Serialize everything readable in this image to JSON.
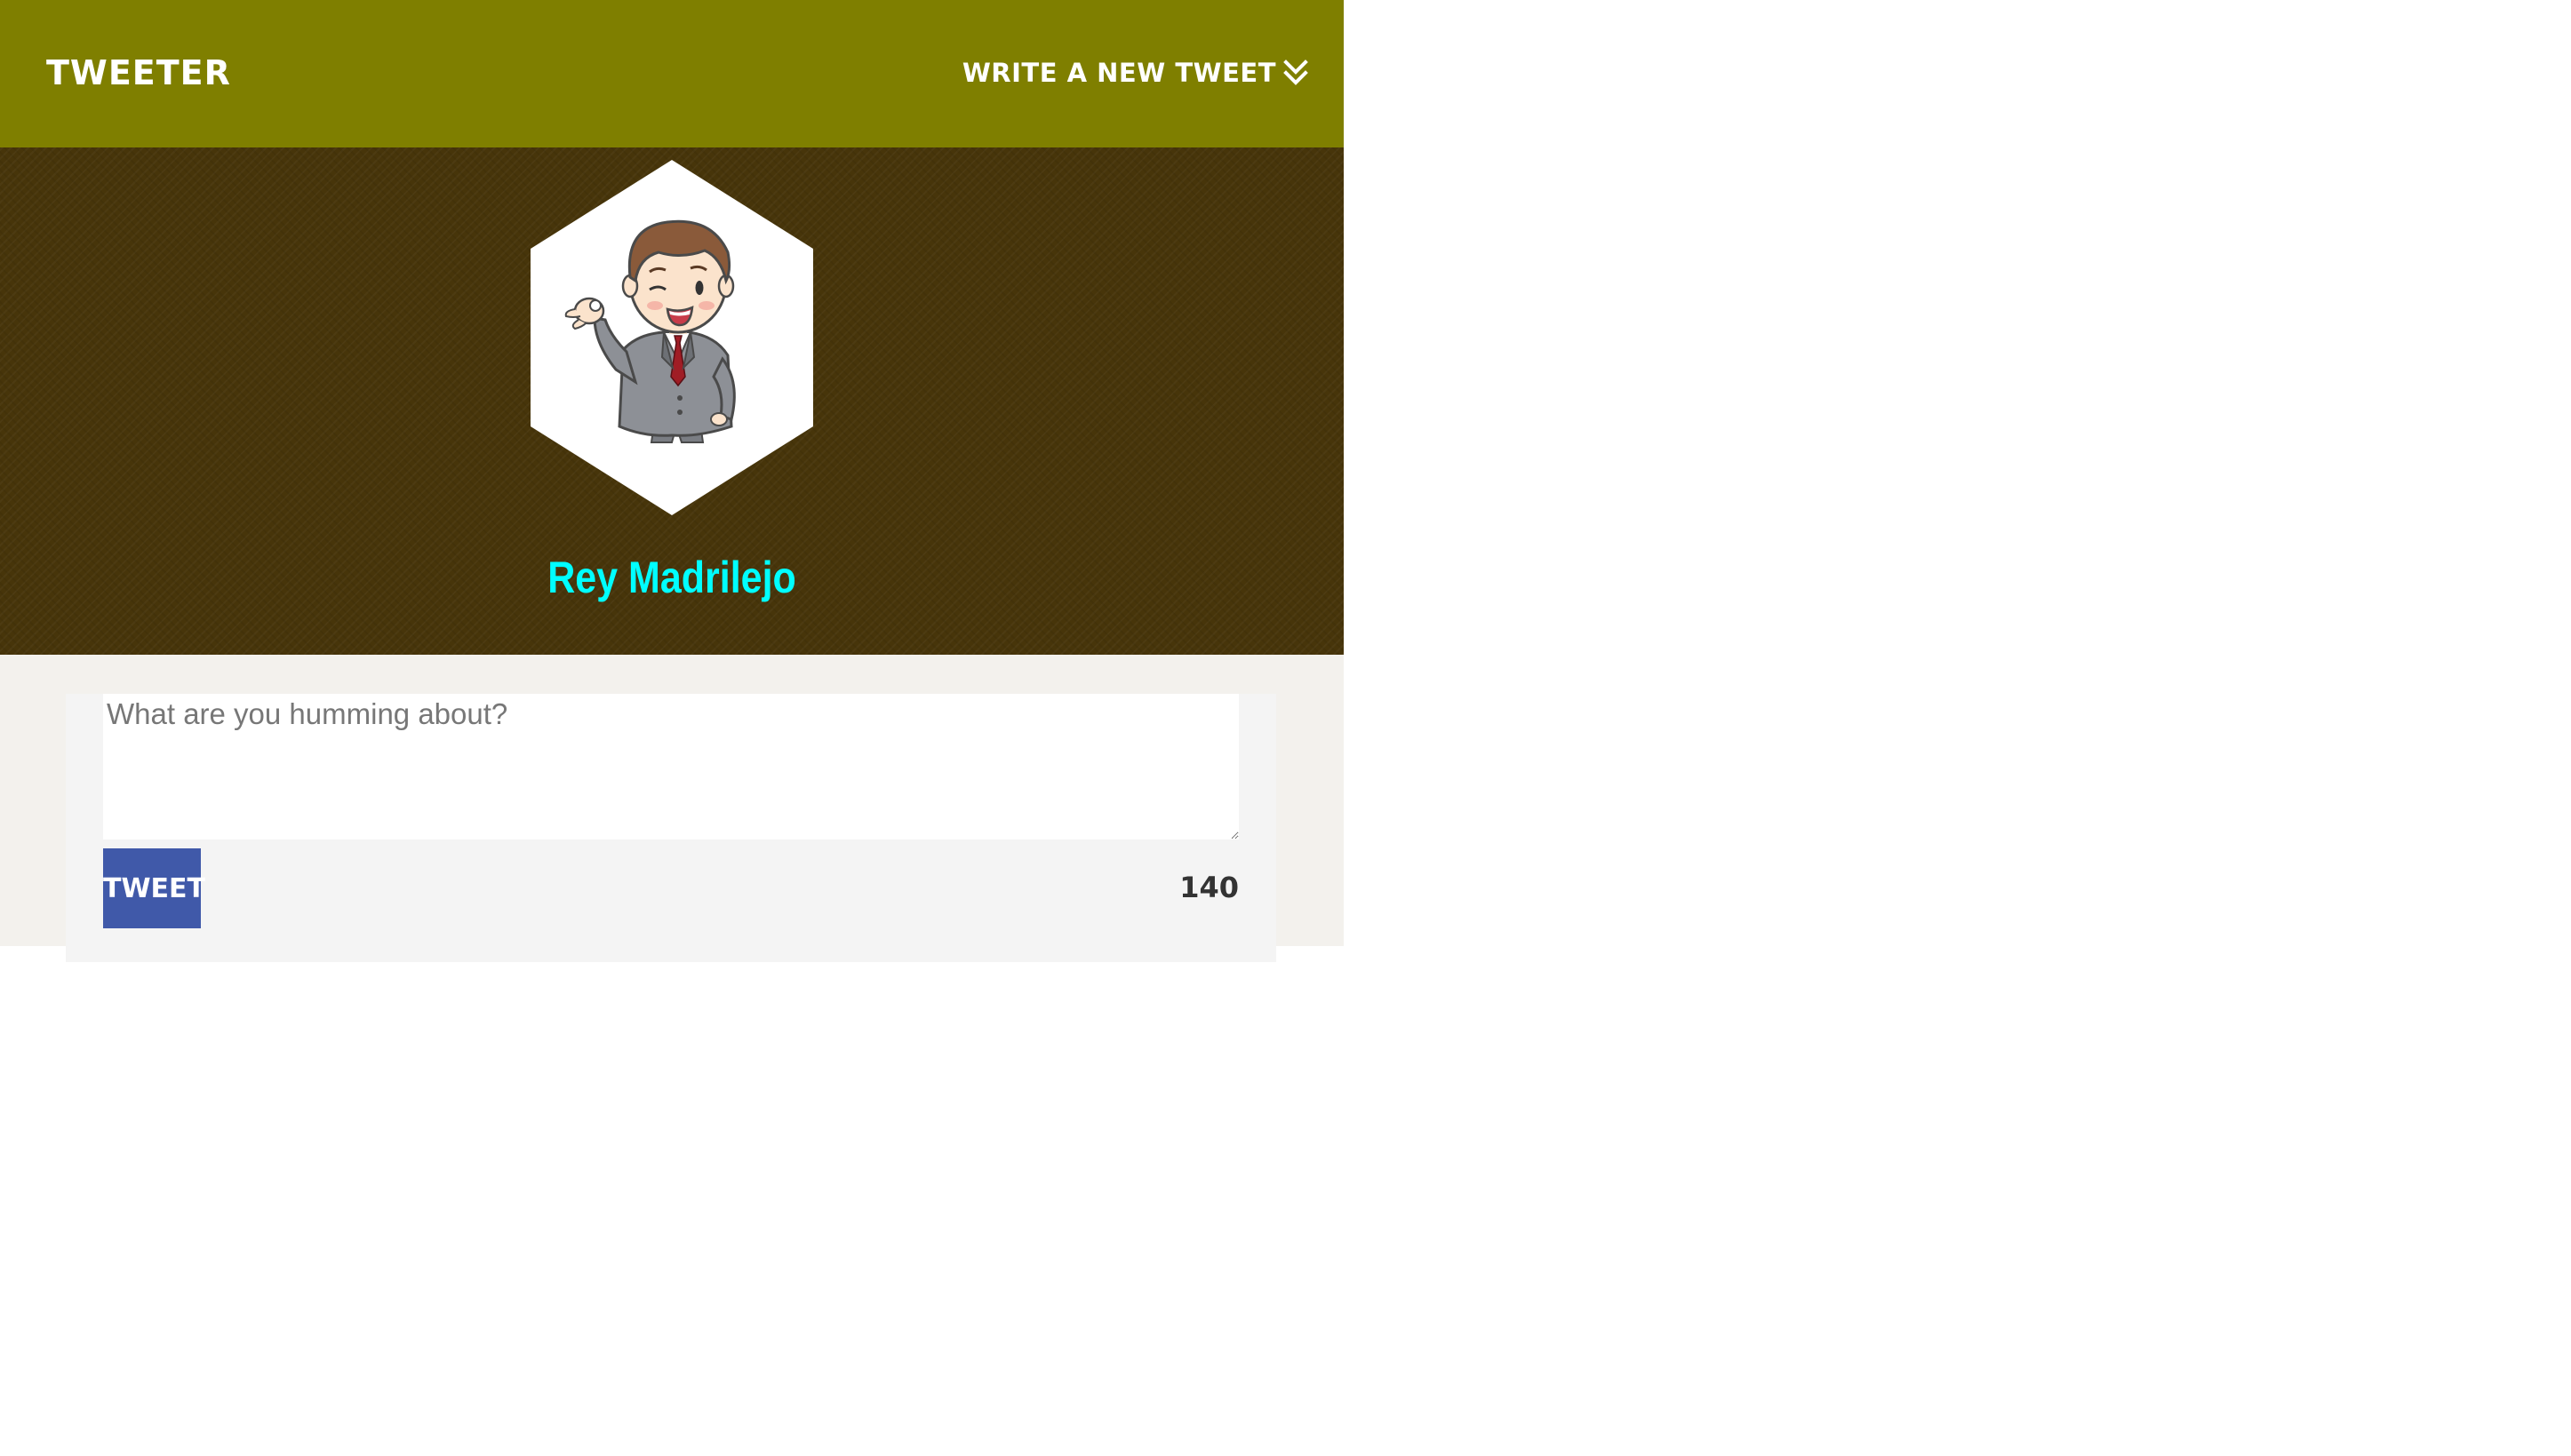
{
  "nav": {
    "brand": "TWEETER",
    "compose_toggle_label": "WRITE A NEW TWEET",
    "compose_toggle_icon": "double-chevron-down-icon"
  },
  "profile": {
    "avatar_icon": "cartoon-businessman-avatar",
    "name": "Rey Madrilejo"
  },
  "composer": {
    "placeholder": "What are you humming about?",
    "value": "",
    "submit_label": "TWEET",
    "char_counter": "140"
  },
  "colors": {
    "nav_background": "#7f7f00",
    "profile_background": "#47350a",
    "profile_name": "#00ffff",
    "compose_background": "#f3f1ed",
    "tweet_button": "#4059a9"
  }
}
